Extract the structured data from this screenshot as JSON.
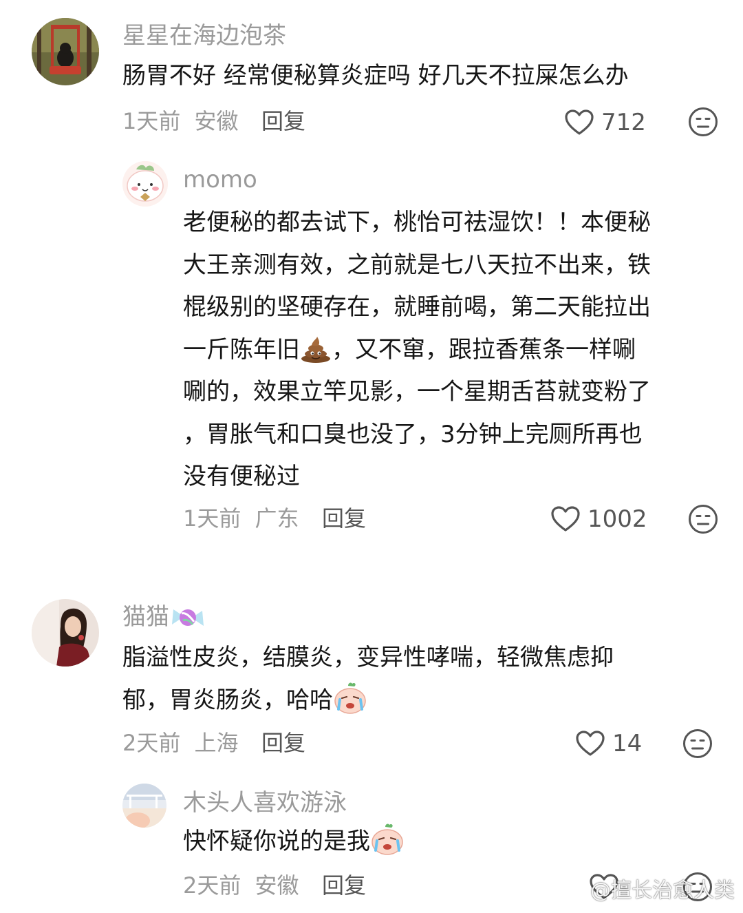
{
  "comments": [
    {
      "username": "星星在海边泡茶",
      "text": "肠胃不好 经常便秘算炎症吗 好几天不拉屎怎么办",
      "time": "1天前",
      "location": "安徽",
      "reply_label": "回复",
      "likes": "712",
      "replies": [
        {
          "username": "momo",
          "lines": [
            "老便秘的都去试下，桃怡可祛湿饮！！本便秘",
            "大王亲测有效，之前就是七八天拉不出来，铁",
            "棍级别的坚硬存在，就睡前喝，第二天能拉出",
            "一斤陈年旧",
            "，又不窜，跟拉香蕉条一样唰",
            "唰的，效果立竿见影，一个星期舌苔就变粉了",
            "，胃胀气和口臭也没了，3分钟上完厕所再也",
            "没有便秘过"
          ],
          "time": "1天前",
          "location": "广东",
          "reply_label": "回复",
          "likes": "1002"
        }
      ]
    },
    {
      "username": "猫猫",
      "lines": [
        "脂溢性皮炎，结膜炎，变异性哮喘，轻微焦虑抑",
        "郁，胃炎肠炎，哈哈"
      ],
      "time": "2天前",
      "location": "上海",
      "reply_label": "回复",
      "likes": "14",
      "replies": [
        {
          "username": "木头人喜欢游泳",
          "text": "快怀疑你说的是我",
          "time": "2天前",
          "location": "安徽",
          "reply_label": "回复"
        }
      ]
    }
  ],
  "watermark": "@擅长治愈人类",
  "icons": {
    "like": "heart-outline-icon",
    "dislike": "meh-face-icon",
    "poop": "poop-emoji",
    "candy": "candy-emoji",
    "crying": "crying-face-sticker",
    "weibo": "weibo-logo-icon"
  },
  "colors": {
    "username": "#9a9a9a",
    "meta": "#9a9a9a",
    "text": "#161616",
    "reply": "#555555"
  }
}
